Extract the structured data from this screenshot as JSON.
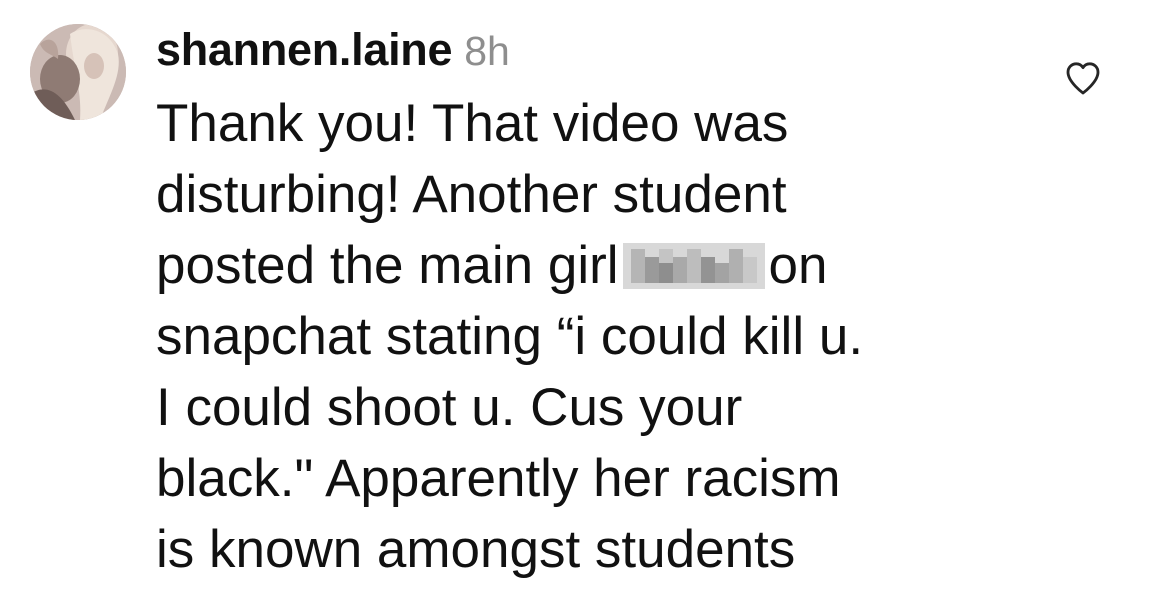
{
  "comment": {
    "username": "shannen.laine",
    "timestamp": "8h",
    "lines": [
      "Thank you! That video was",
      "disturbing! Another student",
      "posted the main girl",
      "on",
      "snapchat stating “i could kill u.",
      "I could shoot u. Cus your",
      "black.\" Apparently her racism",
      "is known amongst students"
    ]
  },
  "icons": {
    "avatar": "profile-photo",
    "like": "heart-icon",
    "redaction": "pixelated-name"
  },
  "colors": {
    "text": "#111111",
    "timestamp": "#8e8e8e",
    "heart_outline": "#262626"
  }
}
